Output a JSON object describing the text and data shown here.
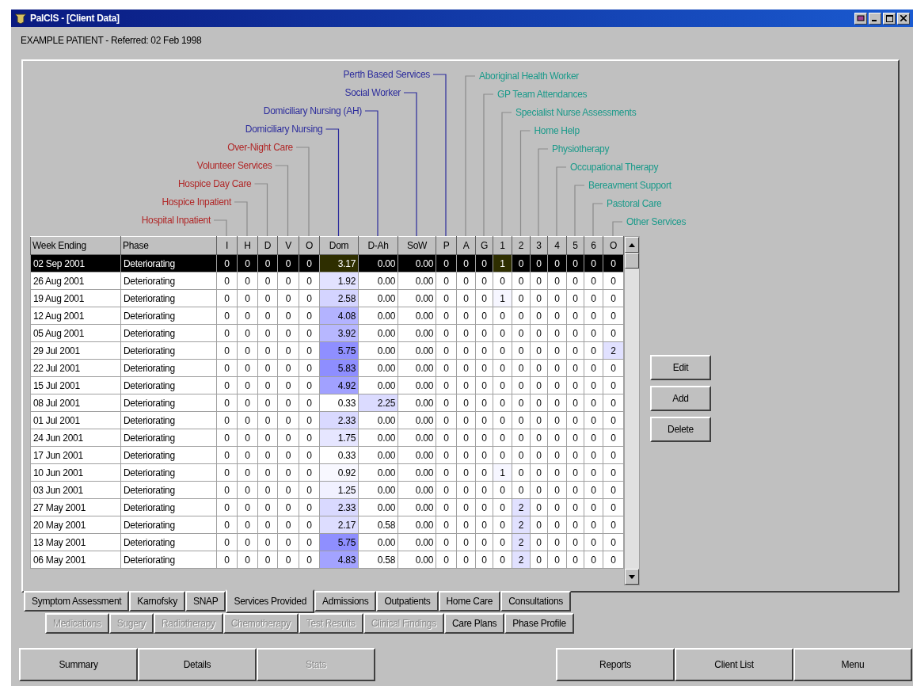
{
  "window": {
    "title": "PalCIS - [Client Data]"
  },
  "patient_line": "EXAMPLE PATIENT - Referred: 02 Feb 1998",
  "columns": [
    {
      "header": "Week Ending"
    },
    {
      "header": "Phase"
    },
    {
      "header": "I",
      "service": {
        "label": "Hospital Inpatient",
        "color": "#b02828",
        "kind": "left"
      }
    },
    {
      "header": "H",
      "service": {
        "label": "Hospice Inpatient",
        "color": "#b02828",
        "kind": "left"
      }
    },
    {
      "header": "D",
      "service": {
        "label": "Hospice Day Care",
        "color": "#b02828",
        "kind": "left"
      }
    },
    {
      "header": "V",
      "service": {
        "label": "Volunteer Services",
        "color": "#b02828",
        "kind": "left"
      }
    },
    {
      "header": "O",
      "service": {
        "label": "Over-Night Care",
        "color": "#b02828",
        "kind": "left"
      }
    },
    {
      "header": "Dom",
      "service": {
        "label": "Domiciliary Nursing",
        "color": "#2c2c9c",
        "kind": "left"
      }
    },
    {
      "header": "D-Ah",
      "service": {
        "label": "Domiciliary Nursing (AH)",
        "color": "#2c2c9c",
        "kind": "left"
      }
    },
    {
      "header": "SoW",
      "service": {
        "label": "Social Worker",
        "color": "#2c2c9c",
        "kind": "left"
      }
    },
    {
      "header": "P",
      "service": {
        "label": "Perth Based Services",
        "color": "#2c2c9c",
        "kind": "left"
      }
    },
    {
      "header": "A",
      "service": {
        "label": "Aboriginal Health Worker",
        "color": "#1a9a8a",
        "kind": "right"
      }
    },
    {
      "header": "G",
      "service": {
        "label": "GP Team Attendances",
        "color": "#1a9a8a",
        "kind": "right"
      }
    },
    {
      "header": "1",
      "service": {
        "label": "Specialist Nurse Assessments",
        "color": "#1a9a8a",
        "kind": "right"
      }
    },
    {
      "header": "2",
      "service": {
        "label": "Home Help",
        "color": "#1a9a8a",
        "kind": "right"
      }
    },
    {
      "header": "3",
      "service": {
        "label": "Physiotherapy",
        "color": "#1a9a8a",
        "kind": "right"
      }
    },
    {
      "header": "4",
      "service": {
        "label": "Occupational Therapy",
        "color": "#1a9a8a",
        "kind": "right"
      }
    },
    {
      "header": "5",
      "service": {
        "label": "Bereavment Support",
        "color": "#1a9a8a",
        "kind": "right"
      }
    },
    {
      "header": "6",
      "service": {
        "label": "Pastoral Care",
        "color": "#1a9a8a",
        "kind": "right"
      }
    },
    {
      "header": "O",
      "service": {
        "label": "Other Services",
        "color": "#1a9a8a",
        "kind": "right"
      }
    }
  ],
  "rows": [
    {
      "week": "02 Sep 2001",
      "phase": "Deteriorating",
      "selected": true,
      "values": [
        "0",
        "0",
        "0",
        "0",
        "0",
        "3.17",
        "0.00",
        "0.00",
        "0",
        "0",
        "0",
        "1",
        "0",
        "0",
        "0",
        "0",
        "0",
        "0"
      ]
    },
    {
      "week": "26 Aug 2001",
      "phase": "Deteriorating",
      "selected": false,
      "values": [
        "0",
        "0",
        "0",
        "0",
        "0",
        "1.92",
        "0.00",
        "0.00",
        "0",
        "0",
        "0",
        "0",
        "0",
        "0",
        "0",
        "0",
        "0",
        "0"
      ]
    },
    {
      "week": "19 Aug 2001",
      "phase": "Deteriorating",
      "selected": false,
      "values": [
        "0",
        "0",
        "0",
        "0",
        "0",
        "2.58",
        "0.00",
        "0.00",
        "0",
        "0",
        "0",
        "1",
        "0",
        "0",
        "0",
        "0",
        "0",
        "0"
      ]
    },
    {
      "week": "12 Aug 2001",
      "phase": "Deteriorating",
      "selected": false,
      "values": [
        "0",
        "0",
        "0",
        "0",
        "0",
        "4.08",
        "0.00",
        "0.00",
        "0",
        "0",
        "0",
        "0",
        "0",
        "0",
        "0",
        "0",
        "0",
        "0"
      ]
    },
    {
      "week": "05 Aug 2001",
      "phase": "Deteriorating",
      "selected": false,
      "values": [
        "0",
        "0",
        "0",
        "0",
        "0",
        "3.92",
        "0.00",
        "0.00",
        "0",
        "0",
        "0",
        "0",
        "0",
        "0",
        "0",
        "0",
        "0",
        "0"
      ]
    },
    {
      "week": "29 Jul 2001",
      "phase": "Deteriorating",
      "selected": false,
      "values": [
        "0",
        "0",
        "0",
        "0",
        "0",
        "5.75",
        "0.00",
        "0.00",
        "0",
        "0",
        "0",
        "0",
        "0",
        "0",
        "0",
        "0",
        "0",
        "2"
      ]
    },
    {
      "week": "22 Jul 2001",
      "phase": "Deteriorating",
      "selected": false,
      "values": [
        "0",
        "0",
        "0",
        "0",
        "0",
        "5.83",
        "0.00",
        "0.00",
        "0",
        "0",
        "0",
        "0",
        "0",
        "0",
        "0",
        "0",
        "0",
        "0"
      ]
    },
    {
      "week": "15 Jul 2001",
      "phase": "Deteriorating",
      "selected": false,
      "values": [
        "0",
        "0",
        "0",
        "0",
        "0",
        "4.92",
        "0.00",
        "0.00",
        "0",
        "0",
        "0",
        "0",
        "0",
        "0",
        "0",
        "0",
        "0",
        "0"
      ]
    },
    {
      "week": "08 Jul 2001",
      "phase": "Deteriorating",
      "selected": false,
      "values": [
        "0",
        "0",
        "0",
        "0",
        "0",
        "0.33",
        "2.25",
        "0.00",
        "0",
        "0",
        "0",
        "0",
        "0",
        "0",
        "0",
        "0",
        "0",
        "0"
      ]
    },
    {
      "week": "01 Jul 2001",
      "phase": "Deteriorating",
      "selected": false,
      "values": [
        "0",
        "0",
        "0",
        "0",
        "0",
        "2.33",
        "0.00",
        "0.00",
        "0",
        "0",
        "0",
        "0",
        "0",
        "0",
        "0",
        "0",
        "0",
        "0"
      ]
    },
    {
      "week": "24 Jun 2001",
      "phase": "Deteriorating",
      "selected": false,
      "values": [
        "0",
        "0",
        "0",
        "0",
        "0",
        "1.75",
        "0.00",
        "0.00",
        "0",
        "0",
        "0",
        "0",
        "0",
        "0",
        "0",
        "0",
        "0",
        "0"
      ]
    },
    {
      "week": "17 Jun 2001",
      "phase": "Deteriorating",
      "selected": false,
      "values": [
        "0",
        "0",
        "0",
        "0",
        "0",
        "0.33",
        "0.00",
        "0.00",
        "0",
        "0",
        "0",
        "0",
        "0",
        "0",
        "0",
        "0",
        "0",
        "0"
      ]
    },
    {
      "week": "10 Jun 2001",
      "phase": "Deteriorating",
      "selected": false,
      "values": [
        "0",
        "0",
        "0",
        "0",
        "0",
        "0.92",
        "0.00",
        "0.00",
        "0",
        "0",
        "0",
        "1",
        "0",
        "0",
        "0",
        "0",
        "0",
        "0"
      ]
    },
    {
      "week": "03 Jun 2001",
      "phase": "Deteriorating",
      "selected": false,
      "values": [
        "0",
        "0",
        "0",
        "0",
        "0",
        "1.25",
        "0.00",
        "0.00",
        "0",
        "0",
        "0",
        "0",
        "0",
        "0",
        "0",
        "0",
        "0",
        "0"
      ]
    },
    {
      "week": "27 May 2001",
      "phase": "Deteriorating",
      "selected": false,
      "values": [
        "0",
        "0",
        "0",
        "0",
        "0",
        "2.33",
        "0.00",
        "0.00",
        "0",
        "0",
        "0",
        "0",
        "2",
        "0",
        "0",
        "0",
        "0",
        "0"
      ]
    },
    {
      "week": "20 May 2001",
      "phase": "Deteriorating",
      "selected": false,
      "values": [
        "0",
        "0",
        "0",
        "0",
        "0",
        "2.17",
        "0.58",
        "0.00",
        "0",
        "0",
        "0",
        "0",
        "2",
        "0",
        "0",
        "0",
        "0",
        "0"
      ]
    },
    {
      "week": "13 May 2001",
      "phase": "Deteriorating",
      "selected": false,
      "values": [
        "0",
        "0",
        "0",
        "0",
        "0",
        "5.75",
        "0.00",
        "0.00",
        "0",
        "0",
        "0",
        "0",
        "2",
        "0",
        "0",
        "0",
        "0",
        "0"
      ]
    },
    {
      "week": "06 May 2001",
      "phase": "Deteriorating",
      "selected": false,
      "values": [
        "0",
        "0",
        "0",
        "0",
        "0",
        "4.83",
        "0.58",
        "0.00",
        "0",
        "0",
        "0",
        "0",
        "2",
        "0",
        "0",
        "0",
        "0",
        "0"
      ]
    }
  ],
  "actions": [
    "Edit",
    "Add",
    "Delete"
  ],
  "tabs": [
    {
      "label": "Symptom Assessment",
      "selected": false
    },
    {
      "label": "Karnofsky",
      "selected": false
    },
    {
      "label": "SNAP",
      "selected": false
    },
    {
      "label": "Services Provided",
      "selected": true
    },
    {
      "label": "Admissions",
      "selected": false
    },
    {
      "label": "Outpatients",
      "selected": false
    },
    {
      "label": "Home Care",
      "selected": false
    },
    {
      "label": "Consultations",
      "selected": false
    }
  ],
  "tabs_2": [
    {
      "label": "Medications",
      "disabled": true
    },
    {
      "label": "Sugery",
      "disabled": true
    },
    {
      "label": "Radiotherapy",
      "disabled": true
    },
    {
      "label": "Chemotherapy",
      "disabled": true
    },
    {
      "label": "Test Results",
      "disabled": true
    },
    {
      "label": "Clinical Findings",
      "disabled": true
    },
    {
      "label": "Care Plans",
      "disabled": false
    },
    {
      "label": "Phase Profile",
      "disabled": false
    }
  ],
  "bottom_buttons": [
    {
      "label": "Summary",
      "disabled": false
    },
    {
      "label": "Details",
      "disabled": false
    },
    {
      "label": "Stats",
      "disabled": true
    },
    {
      "label": "Reports",
      "disabled": false
    },
    {
      "label": "Client List",
      "disabled": false
    },
    {
      "label": "Menu",
      "disabled": false
    }
  ]
}
